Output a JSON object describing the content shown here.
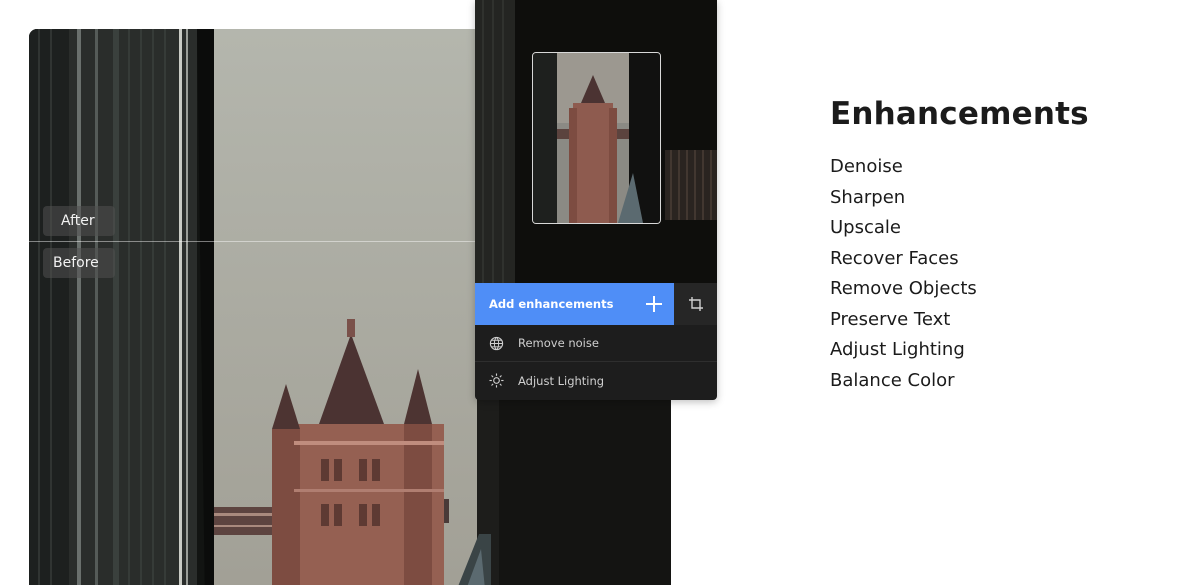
{
  "compare": {
    "after_label": "After",
    "before_label": "Before"
  },
  "panel": {
    "add_button_label": "Add enhancements",
    "items": [
      {
        "label": "Remove noise",
        "icon": "noise-globe-icon"
      },
      {
        "label": "Adjust Lighting",
        "icon": "sun-icon"
      }
    ],
    "accent_color": "#4f8ef7"
  },
  "enhancements": {
    "title": "Enhancements",
    "items": [
      "Denoise",
      "Sharpen",
      "Upscale",
      "Recover Faces",
      "Remove Objects",
      "Preserve Text",
      "Adjust Lighting",
      "Balance Color"
    ]
  }
}
